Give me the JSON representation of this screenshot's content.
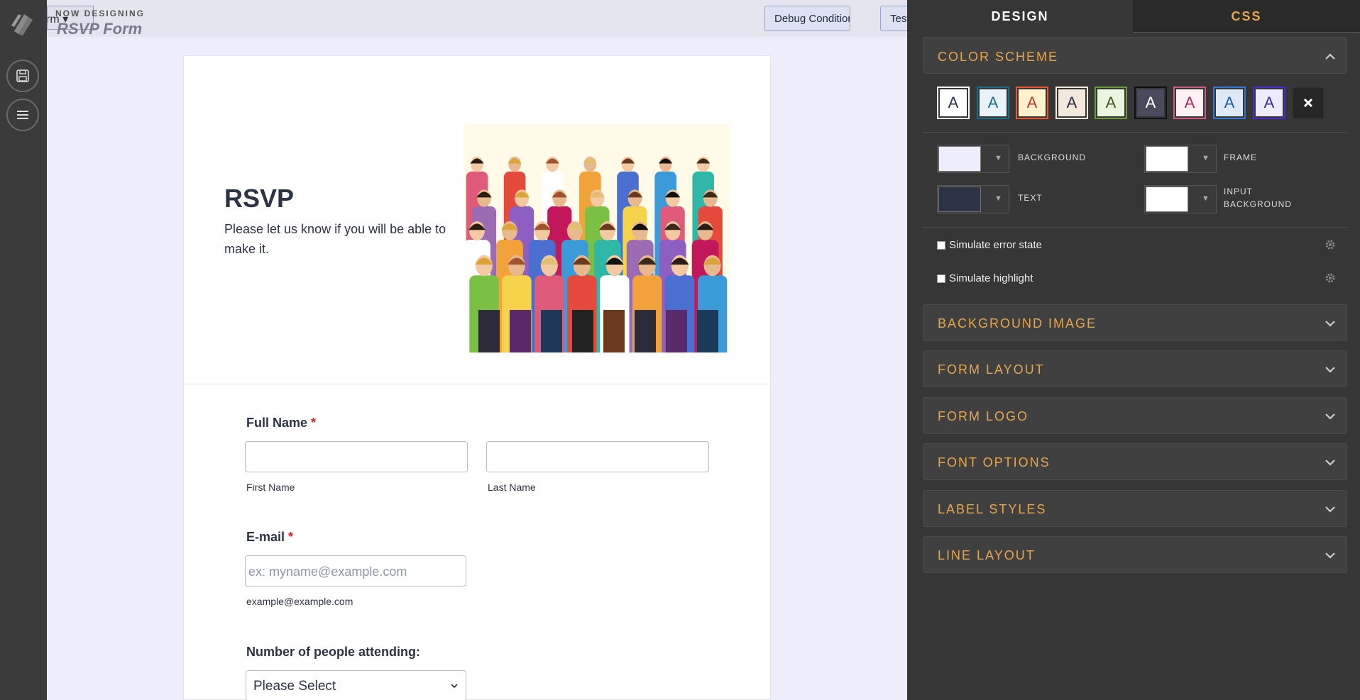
{
  "topbar": {
    "form_button_label": "rm",
    "now_designing": "NOW DESIGNING",
    "form_name": "RSVP Form",
    "debug_label": "Debug Conditions",
    "test_label": "Test"
  },
  "form": {
    "title": "RSVP",
    "subtitle": "Please let us know if you will be able to make it.",
    "full_name_label": "Full Name",
    "required_mark": "*",
    "first_name_sub": "First Name",
    "last_name_sub": "Last Name",
    "email_label": "E-mail",
    "email_placeholder": "ex: myname@example.com",
    "email_sub": "example@example.com",
    "attending_label": "Number of people attending:",
    "attending_value": "Please Select"
  },
  "panel": {
    "tabs": [
      "DESIGN",
      "CSS"
    ],
    "active_tab": "DESIGN",
    "sections": [
      "COLOR SCHEME",
      "BACKGROUND IMAGE",
      "FORM LAYOUT",
      "FORM LOGO",
      "FONT OPTIONS",
      "LABEL STYLES",
      "LINE LAYOUT"
    ],
    "swatch_letter": "A",
    "swatches": [
      {
        "bg": "#ffffff",
        "fg": "#2c3345",
        "border": "#ffffff"
      },
      {
        "bg": "#e8f4f8",
        "fg": "#1b6d8c",
        "border": "#1b6d8c"
      },
      {
        "bg": "#fff2cc",
        "fg": "#c0392b",
        "border": "#e8572e"
      },
      {
        "bg": "#f2e8dc",
        "fg": "#2c3345",
        "border": "#f2e8dc"
      },
      {
        "bg": "#eaf4df",
        "fg": "#3c5e1e",
        "border": "#6b9a3a"
      },
      {
        "bg": "#4a4a5e",
        "fg": "#ffffff",
        "border": "#111111"
      },
      {
        "bg": "#fff0f4",
        "fg": "#b0285a",
        "border": "#d15a86"
      },
      {
        "bg": "#dde9f7",
        "fg": "#1f5fa8",
        "border": "#2f7ad1"
      },
      {
        "bg": "#eeeaff",
        "fg": "#3d2c9c",
        "border": "#4b2bd0"
      }
    ],
    "clear_icon": "close-icon",
    "colors": {
      "background_label": "BACKGROUND",
      "background_value": "#ededfb",
      "frame_label": "FRAME",
      "frame_value": "#ffffff",
      "text_label": "TEXT",
      "text_value": "#2c3345",
      "input_bg_label_1": "INPUT",
      "input_bg_label_2": "BACKGROUND",
      "input_bg_value": "#ffffff"
    },
    "simulate_error": "Simulate error state",
    "simulate_highlight": "Simulate highlight",
    "accent": "#e8a64b"
  }
}
